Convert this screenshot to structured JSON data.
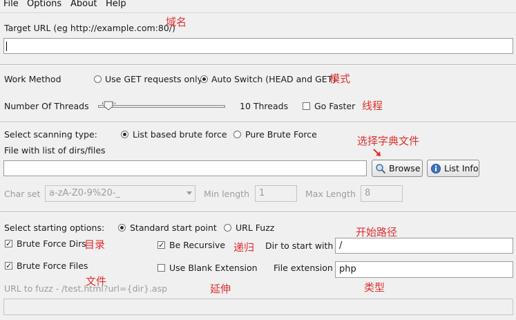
{
  "menu": {
    "file": "File",
    "options": "Options",
    "about": "About",
    "help": "Help"
  },
  "target": {
    "label": "Target URL (eg http://example.com:80/)",
    "value": "",
    "annotation": "域名"
  },
  "work_method": {
    "label": "Work Method",
    "option_get": "Use GET requests only",
    "option_auto": "Auto Switch (HEAD and GET)",
    "selected": "auto",
    "annotation": "模式"
  },
  "threads": {
    "label": "Number Of Threads",
    "value_text": "10 Threads",
    "go_faster": "Go Faster",
    "go_faster_checked": false,
    "annotation": "线程"
  },
  "scan_type": {
    "label": "Select scanning type:",
    "option_list": "List based brute force",
    "option_pure": "Pure Brute Force",
    "selected": "list"
  },
  "dir_file": {
    "label": "File with list of dirs/files",
    "value": "",
    "browse": "Browse",
    "list_info": "List Info",
    "annotation": "选择字典文件"
  },
  "charset": {
    "label": "Char set",
    "value": "a-zA-Z0-9%20-_",
    "min_label": "Min length",
    "min_value": "1",
    "max_label": "Max Length",
    "max_value": "8"
  },
  "start_options": {
    "label": "Select starting options:",
    "option_standard": "Standard start point",
    "option_fuzz": "URL Fuzz",
    "selected": "standard",
    "annotation": "开始路径"
  },
  "brute_dirs": {
    "label": "Brute Force Dirs",
    "checked": true,
    "annotation": "目录"
  },
  "recursive": {
    "label": "Be Recursive",
    "checked": true,
    "annotation": "递归"
  },
  "dir_start": {
    "label": "Dir to start with",
    "value": "/"
  },
  "brute_files": {
    "label": "Brute Force Files",
    "checked": true,
    "annotation": "文件"
  },
  "blank_ext": {
    "label": "Use Blank Extension",
    "checked": false,
    "annotation": "延伸"
  },
  "file_ext": {
    "label": "File extension",
    "value": "php",
    "annotation": "类型"
  },
  "fuzz": {
    "label": "URL to fuzz - /test.html?url={dir}.asp",
    "value": ""
  },
  "colors": {
    "annotation": "#e03030",
    "background": "#f0f0f0"
  }
}
